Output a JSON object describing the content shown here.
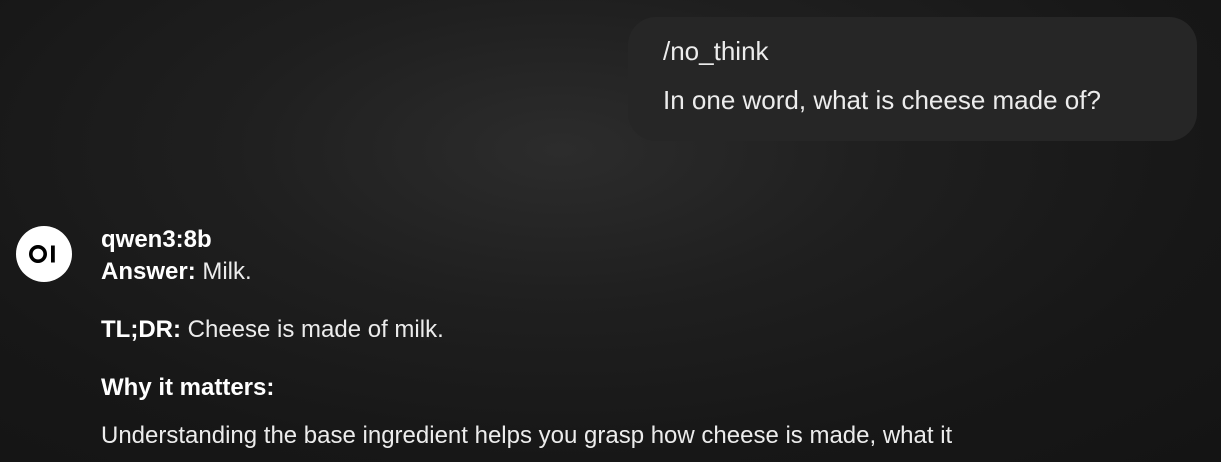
{
  "user_message": {
    "lines": [
      "/no_think",
      "In one word, what is cheese made of?"
    ]
  },
  "assistant_message": {
    "avatar_icon": "open-webui-logo-icon",
    "model_name": "qwen3:8b",
    "answer_label": "Answer:",
    "answer_text": " Milk.",
    "tldr_label": "TL;DR:",
    "tldr_text": " Cheese is made of milk.",
    "why_heading": "Why it matters:",
    "why_text": "Understanding the base ingredient helps you grasp how cheese is made, what it"
  }
}
